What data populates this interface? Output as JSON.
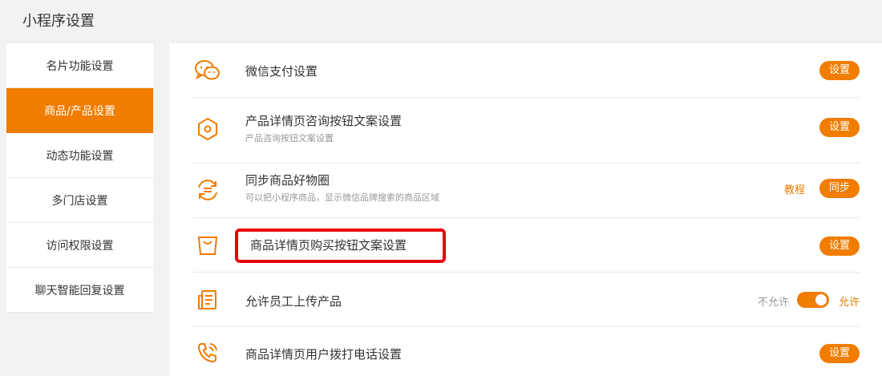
{
  "page": {
    "title": "小程序设置"
  },
  "sidebar": {
    "items": [
      {
        "label": "名片功能设置",
        "active": false
      },
      {
        "label": "商品/产品设置",
        "active": true
      },
      {
        "label": "动态功能设置",
        "active": false
      },
      {
        "label": "多门店设置",
        "active": false
      },
      {
        "label": "访问权限设置",
        "active": false
      },
      {
        "label": "聊天智能回复设置",
        "active": false
      }
    ]
  },
  "settings": [
    {
      "icon": "wechat-icon",
      "title": "微信支付设置",
      "subtitle": "",
      "button": "设置"
    },
    {
      "icon": "hexagon-icon",
      "title": "产品详情页咨询按钮文案设置",
      "subtitle": "产品咨询按钮文案设置",
      "button": "设置"
    },
    {
      "icon": "sync-icon",
      "title": "同步商品好物圈",
      "subtitle": "可以把小程序商品，显示微信品牌搜索的商品区域",
      "link": "教程",
      "button": "同步"
    },
    {
      "icon": "shopping-bag-icon",
      "title": "商品详情页购买按钮文案设置",
      "subtitle": "",
      "button": "设置",
      "highlighted": true
    },
    {
      "icon": "document-icon",
      "title": "允许员工上传产品",
      "subtitle": "",
      "toggle": {
        "off_label": "不允许",
        "on_label": "允许",
        "value": true
      }
    },
    {
      "icon": "phone-icon",
      "title": "商品详情页用户拨打电话设置",
      "subtitle": "",
      "button": "设置"
    }
  ],
  "colors": {
    "accent": "#f07c00",
    "highlight": "#e8000c"
  }
}
